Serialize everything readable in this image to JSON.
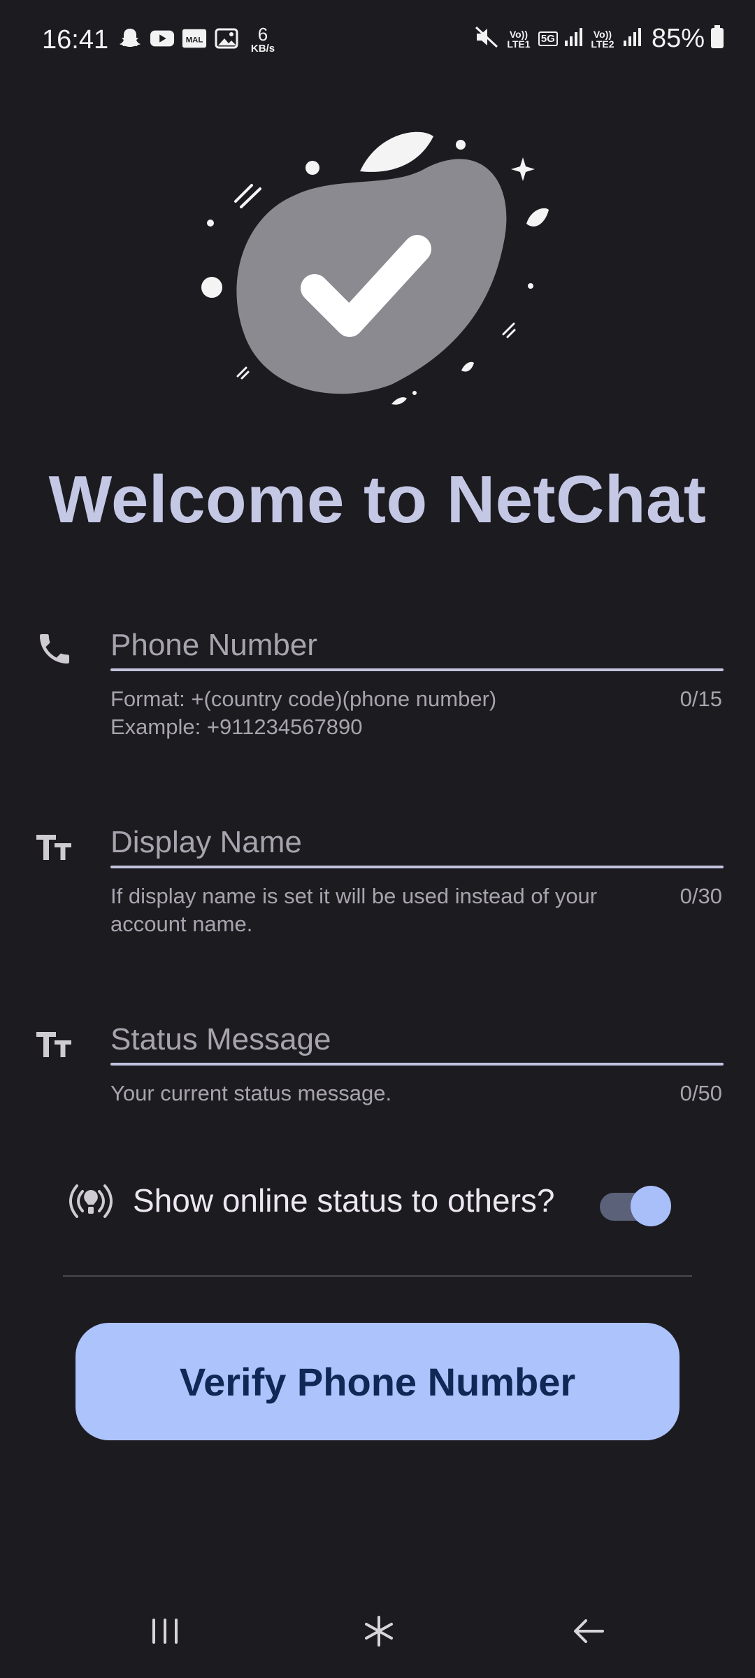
{
  "status_bar": {
    "time": "16:41",
    "speed_value": "6",
    "speed_unit": "KB/s",
    "sim1": "Vo)) LTE1",
    "net_type": "5G",
    "sim2": "Vo)) LTE2",
    "battery": "85%"
  },
  "welcome_title": "Welcome to NetChat",
  "fields": {
    "phone": {
      "label": "Phone Number",
      "helper_line1": "Format: +(country code)(phone number)",
      "helper_line2": "Example: +911234567890",
      "counter": "0/15"
    },
    "display_name": {
      "label": "Display Name",
      "helper": "If display name is set it will be used instead of your account name.",
      "counter": "0/30"
    },
    "status": {
      "label": "Status Message",
      "helper": "Your current status message.",
      "counter": "0/50"
    }
  },
  "online_status": {
    "label": "Show online status to others?",
    "enabled": true
  },
  "verify_button": "Verify Phone Number",
  "icons": {
    "phone": "phone-icon",
    "display_name": "text-format-icon",
    "status": "text-format-icon",
    "online": "broadcast-icon",
    "nav": [
      "recents-icon",
      "home-icon",
      "back-icon"
    ]
  },
  "colors": {
    "background": "#1c1b20",
    "title": "#c5c8e5",
    "button": "#adc3fb",
    "button_text": "#0f2856"
  }
}
